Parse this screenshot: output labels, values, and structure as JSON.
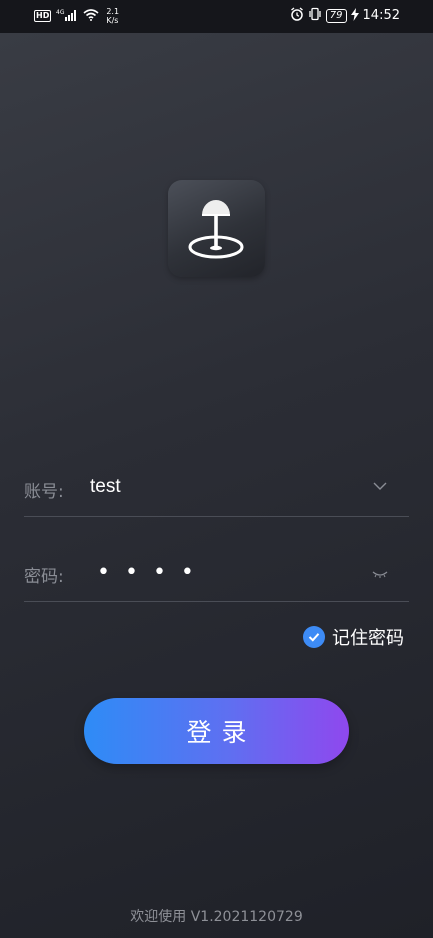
{
  "status_bar": {
    "hd": "HD",
    "network": "4G",
    "speed_value": "2.1",
    "speed_unit": "K/s",
    "battery": "79",
    "time": "14:52",
    "icons": [
      "signal-icon",
      "wifi-icon",
      "alarm-icon",
      "vibrate-icon",
      "battery-icon",
      "charging-icon"
    ]
  },
  "logo": {
    "icon": "gps-antenna-icon"
  },
  "form": {
    "account_label": "账号:",
    "account_value": "test",
    "account_dropdown_icon": "chevron-down-icon",
    "password_label": "密码:",
    "password_masked": "••••",
    "password_toggle_icon": "eye-closed-icon",
    "remember_checked": true,
    "remember_label": "记住密码"
  },
  "login_button": {
    "label": "登录"
  },
  "footer": {
    "text": "欢迎使用 V1.2021120729"
  },
  "colors": {
    "accent_blue": "#2e8cf6",
    "accent_purple": "#8f48ee",
    "check_blue": "#3d8bf5"
  }
}
